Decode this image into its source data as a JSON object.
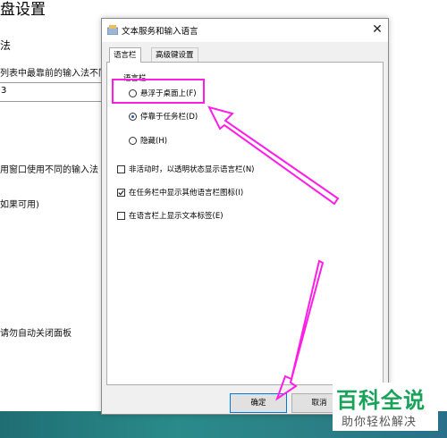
{
  "background": {
    "title": "盘设置",
    "section_label": "法",
    "text_list": "列表中最靠前的输入法不同",
    "select_value": "3",
    "text_window": "用窗口使用不同的输入法",
    "text_available": "如果可用)",
    "text_autoclose": "请勿自动关闭面板"
  },
  "dialog": {
    "title": "文本服务和输入语言",
    "close_glyph": "✕",
    "tabs": [
      {
        "label": "语言栏",
        "active": true
      },
      {
        "label": "高级键设置",
        "active": false
      }
    ],
    "group_label": "语言栏",
    "radios": [
      {
        "label": "悬浮于桌面上(F)",
        "checked": false
      },
      {
        "label": "停靠于任务栏(D)",
        "checked": true
      },
      {
        "label": "隐藏(H)",
        "checked": false
      }
    ],
    "checkboxes": [
      {
        "label": "非活动时，以透明状态显示语言栏(N)",
        "checked": false
      },
      {
        "label": "在任务栏中显示其他语言栏图标(I)",
        "checked": true
      },
      {
        "label": "在语言栏上显示文本标签(E)",
        "checked": false
      }
    ],
    "buttons": {
      "ok": "确定",
      "cancel": "取消"
    }
  },
  "watermark": {
    "top": "百科全说",
    "bottom": "助你轻松解决"
  },
  "colors": {
    "annotation": "#ff1ee6",
    "accent": "#0078d7",
    "watermark": "#19a35a"
  }
}
